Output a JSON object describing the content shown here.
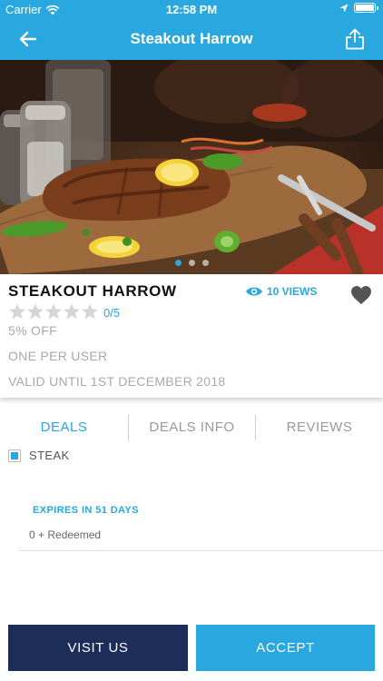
{
  "status_bar": {
    "carrier": "Carrier",
    "time": "12:58 PM"
  },
  "nav": {
    "title": "Steakout Harrow"
  },
  "hero": {
    "active_slide": 1,
    "slide_count": 3
  },
  "venue": {
    "name": "STEAKOUT HARROW",
    "views": "10 VIEWS",
    "rating": "0/5",
    "rating_value": 0,
    "rating_max": 5,
    "discount": "5% OFF",
    "limit": "ONE PER USER",
    "validity": "VALID UNTIL 1ST DECEMBER 2018"
  },
  "tabs": [
    {
      "label": "DEALS",
      "active": true
    },
    {
      "label": "DEALS INFO",
      "active": false
    },
    {
      "label": "REVIEWS",
      "active": false
    }
  ],
  "deal": {
    "item": "STEAK",
    "expires": "EXPIRES IN 51 DAYS",
    "redeemed": "0 + Redeemed"
  },
  "buttons": {
    "visit": "VISIT US",
    "accept": "ACCEPT"
  },
  "colors": {
    "primary": "#29a8e0",
    "navy": "#1c2d5a"
  },
  "icons": [
    "wifi-icon",
    "location-arrow-icon",
    "battery-icon",
    "back-arrow-icon",
    "share-icon",
    "eye-icon",
    "heart-icon",
    "star-icon"
  ]
}
